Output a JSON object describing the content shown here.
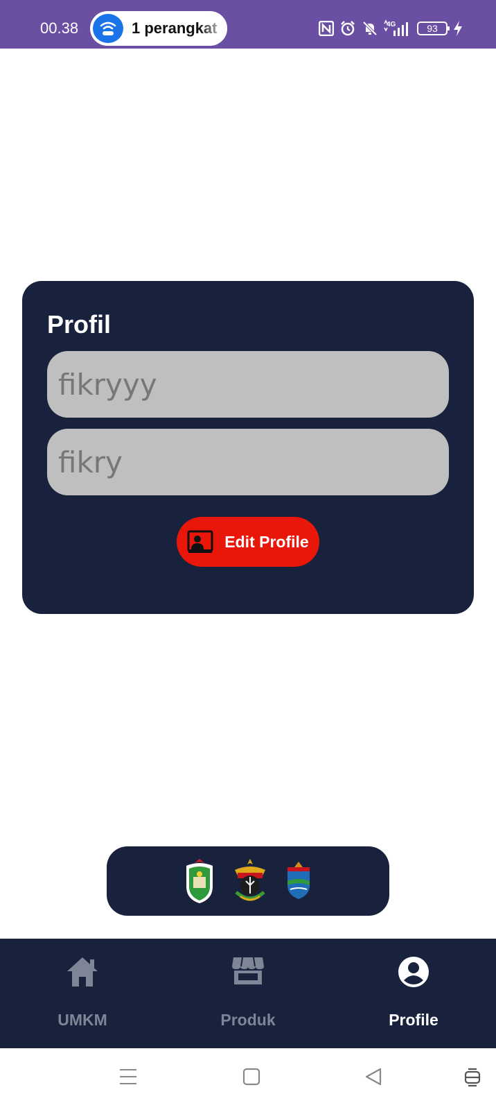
{
  "status_bar": {
    "time": "00.38",
    "hotspot_label": "1 perangkat",
    "battery_level": "93",
    "background": "#6a4fa3"
  },
  "profile_card": {
    "title": "Profil",
    "field_1_value": "fikryyy",
    "field_2_value": "fikry",
    "edit_button_label": "Edit Profile",
    "background": "#19223c",
    "button_color": "#e8170a"
  },
  "logos": [
    {
      "name": "green-shield-emblem"
    },
    {
      "name": "garuda-emblem"
    },
    {
      "name": "blue-shield-emblem"
    }
  ],
  "bottom_nav": {
    "items": [
      {
        "label": "UMKM",
        "icon": "home-icon",
        "active": false
      },
      {
        "label": "Produk",
        "icon": "store-icon",
        "active": false
      },
      {
        "label": "Profile",
        "icon": "account-circle-icon",
        "active": true
      }
    ]
  },
  "system_nav": {
    "buttons": [
      "menu-icon",
      "home-square-icon",
      "back-triangle-icon",
      "accessibility-icon"
    ]
  }
}
